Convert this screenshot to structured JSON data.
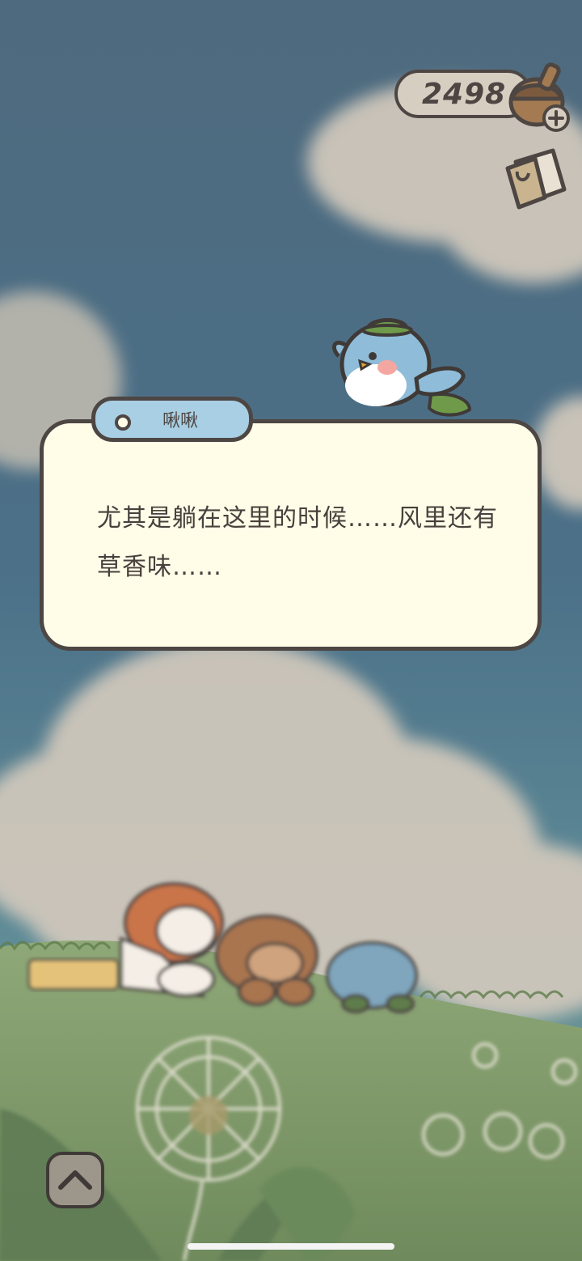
{
  "currency": {
    "amount": "2498",
    "icon": "acorn-icon",
    "add_icon": "plus-icon"
  },
  "shop": {
    "icon": "shop-bag-icon"
  },
  "dialog": {
    "speaker": "啾啾",
    "text": "尤其是躺在这里的时候……风里还有草香味……"
  },
  "controls": {
    "expand_icon": "chevron-up-icon"
  },
  "colors": {
    "sky": "#4f6f87",
    "cloud": "#c9c1b5",
    "grass": "#7a9a64",
    "dialog_bg": "#fffde8",
    "outline": "#4d4643",
    "name_tag": "#a8cfe3"
  }
}
